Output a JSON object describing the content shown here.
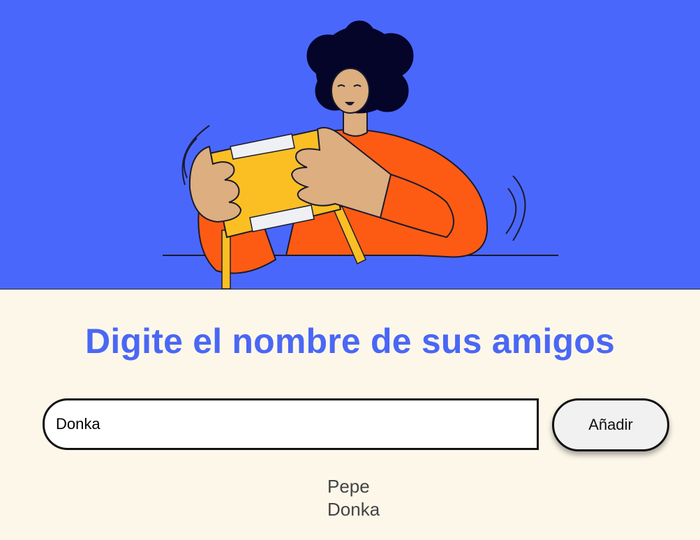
{
  "hero": {
    "illustration": "person-playing-handheld-console",
    "colors": {
      "background": "#4a67fc",
      "skin": "#dcae80",
      "shirt": "#fd5b14",
      "console": "#fbbf24",
      "hair": "#05052a"
    }
  },
  "heading": "Digite el nombre de sus amigos",
  "form": {
    "input_value": "Donka",
    "add_label": "Añadir"
  },
  "friends": [
    "Pepe",
    "Donka"
  ],
  "colors": {
    "accent": "#4a67f5",
    "page_background": "#fdf7ea"
  }
}
